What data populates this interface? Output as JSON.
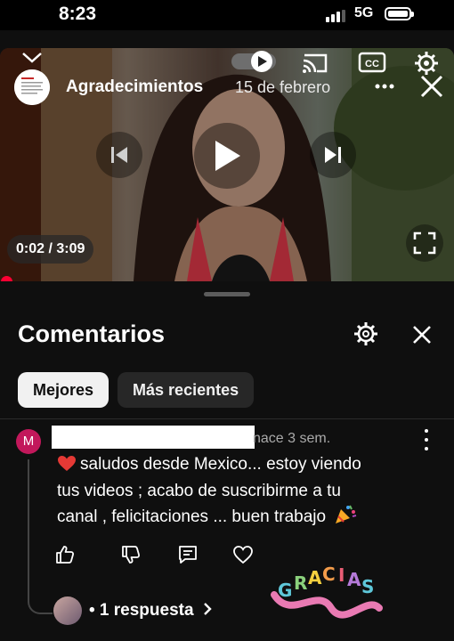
{
  "status_bar": {
    "time": "8:23",
    "network": "5G"
  },
  "video": {
    "channel_name": "Agradecimientos",
    "date": "15 de febrero",
    "time_display": "0:02 / 3:09"
  },
  "comments_panel": {
    "title": "Comentarios",
    "sort_chips": [
      {
        "label": "Mejores",
        "active": true
      },
      {
        "label": "Más recientes",
        "active": false
      }
    ],
    "comment": {
      "avatar_letter": "M",
      "age": "nace 3 sem.",
      "lines": [
        "saludos desde Mexico... estoy viendo",
        "tus videos ; acabo de suscribirme a tu",
        "canal , felicitaciones ... buen trabajo"
      ],
      "replies_label": "• 1 respuesta",
      "sticker_text": [
        "G",
        "R",
        "A",
        "C",
        "I",
        "A",
        "S"
      ]
    }
  },
  "colors": {
    "accent_red": "#ff0033",
    "avatar_pink": "#c2185b",
    "background": "#0f0f0f"
  }
}
